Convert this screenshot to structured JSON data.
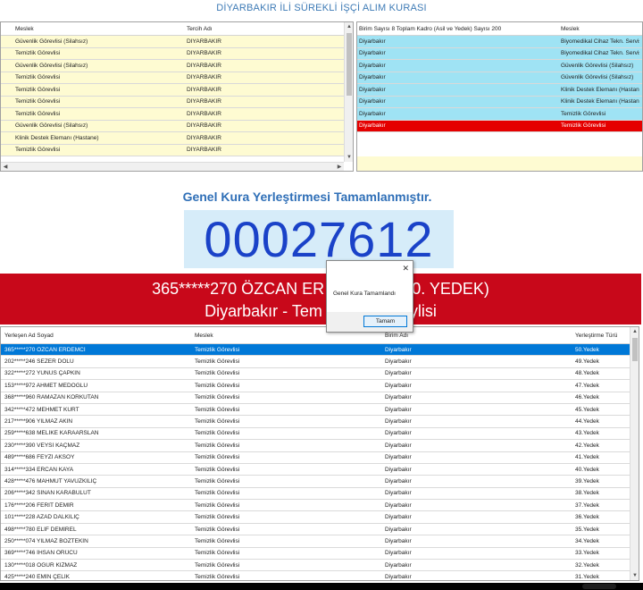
{
  "app": {
    "title": "DİYARBAKIR İLİ SÜREKLİ İŞÇİ ALIM KURASI"
  },
  "left_grid": {
    "headers": [
      "Meslek",
      "Tercih Adı"
    ],
    "rows": [
      [
        "Güvenlik Görevlisi (Silahsız)",
        "DIYARBAKIR"
      ],
      [
        "Temizlik Görevlisi",
        "DIYARBAKIR"
      ],
      [
        "Güvenlik Görevlisi (Silahsız)",
        "DIYARBAKIR"
      ],
      [
        "Temizlik Görevlisi",
        "DIYARBAKIR"
      ],
      [
        "Temizlik Görevlisi",
        "DIYARBAKIR"
      ],
      [
        "Temizlik Görevlisi",
        "DIYARBAKIR"
      ],
      [
        "Temizlik Görevlisi",
        "DIYARBAKIR"
      ],
      [
        "Güvenlik Görevlisi (Silahsız)",
        "DIYARBAKIR"
      ],
      [
        "Klinik Destek Elemanı (Hastane)",
        "DIYARBAKIR"
      ],
      [
        "Temizlik Görevlisi",
        "DIYARBAKIR"
      ]
    ]
  },
  "right_grid": {
    "headers": [
      "Birim Sayısı 8 Toplam Kadro (Asil ve Yedek) Sayısı 200",
      "Meslek"
    ],
    "rows": [
      [
        "Diyarbakır",
        "Biyomedikal Cihaz Tekn. Servis"
      ],
      [
        "Diyarbakır",
        "Biyomedikal Cihaz Tekn. Servis"
      ],
      [
        "Diyarbakır",
        "Güvenlik Görevlisi (Silahsız)"
      ],
      [
        "Diyarbakır",
        "Güvenlik Görevlisi (Silahsız)"
      ],
      [
        "Diyarbakır",
        "Klinik Destek Elemanı (Hastane)"
      ],
      [
        "Diyarbakır",
        "Klinik Destek Elemanı (Hastane)"
      ],
      [
        "Diyarbakır",
        "Temizlik Görevlisi"
      ],
      [
        "Diyarbakır",
        "Temizlik Görevlisi"
      ]
    ],
    "selected_index": 7
  },
  "result": {
    "heading": "Genel Kura Yerleştirmesi Tamamlanmıştır.",
    "code": "00027612",
    "banner_line1": "365*****270 ÖZCAN ER",
    "banner_line1_end": "0. YEDEK)",
    "banner_line2": "Diyarbakır - Tem",
    "banner_line2_end": "ylisi"
  },
  "dialog": {
    "message": "Genel Kura Tamamlandı",
    "ok_label": "Tamam",
    "close_symbol": "✕"
  },
  "bottom_grid": {
    "headers": [
      "Yerleşen Ad Soyad",
      "Meslek",
      "Birim Adı",
      "Yerleştirme Türü"
    ],
    "rows": [
      [
        "365*****270 ÖZCAN ERDEMCİ",
        "Temizlik Görevlisi",
        "Diyarbakır",
        "50.Yedek"
      ],
      [
        "202*****246 SEZER DOLU",
        "Temizlik Görevlisi",
        "Diyarbakır",
        "49.Yedek"
      ],
      [
        "322*****272 YUNUS ÇAPKIN",
        "Temizlik Görevlisi",
        "Diyarbakır",
        "48.Yedek"
      ],
      [
        "153*****972 AHMET MEDOĞLU",
        "Temizlik Görevlisi",
        "Diyarbakır",
        "47.Yedek"
      ],
      [
        "368*****960 RAMAZAN KORKUTAN",
        "Temizlik Görevlisi",
        "Diyarbakır",
        "46.Yedek"
      ],
      [
        "342*****472 MEHMET KURT",
        "Temizlik Görevlisi",
        "Diyarbakır",
        "45.Yedek"
      ],
      [
        "217*****906 YILMAZ AKIN",
        "Temizlik Görevlisi",
        "Diyarbakır",
        "44.Yedek"
      ],
      [
        "259*****638 MELİKE KARAARSLAN",
        "Temizlik Görevlisi",
        "Diyarbakır",
        "43.Yedek"
      ],
      [
        "230*****390 VEYSİ KAÇMAZ",
        "Temizlik Görevlisi",
        "Diyarbakır",
        "42.Yedek"
      ],
      [
        "489*****686 FEYZİ AKSOY",
        "Temizlik Görevlisi",
        "Diyarbakır",
        "41.Yedek"
      ],
      [
        "314*****334 ERCAN KAYA",
        "Temizlik Görevlisi",
        "Diyarbakır",
        "40.Yedek"
      ],
      [
        "428*****476 MAHMUT YAVUZKILIÇ",
        "Temizlik Görevlisi",
        "Diyarbakır",
        "39.Yedek"
      ],
      [
        "206*****342 SİNAN KARABULUT",
        "Temizlik Görevlisi",
        "Diyarbakır",
        "38.Yedek"
      ],
      [
        "176*****206 FERİT DEMİR",
        "Temizlik Görevlisi",
        "Diyarbakır",
        "37.Yedek"
      ],
      [
        "101*****228 AZAD DALKILIÇ",
        "Temizlik Görevlisi",
        "Diyarbakır",
        "36.Yedek"
      ],
      [
        "498*****780 ELİF DEMİREL",
        "Temizlik Görevlisi",
        "Diyarbakır",
        "35.Yedek"
      ],
      [
        "250*****074 YILMAZ BOZTEKİN",
        "Temizlik Görevlisi",
        "Diyarbakır",
        "34.Yedek"
      ],
      [
        "369*****746 İHSAN ÖRÜCÜ",
        "Temizlik Görevlisi",
        "Diyarbakır",
        "33.Yedek"
      ],
      [
        "130*****018 OĞUR KIZMAZ",
        "Temizlik Görevlisi",
        "Diyarbakır",
        "32.Yedek"
      ],
      [
        "425*****240 EMİN ÇELİK",
        "Temizlik Görevlisi",
        "Diyarbakır",
        "31.Yedek"
      ]
    ],
    "selected_index": 0
  },
  "icons": {
    "scroll_up": "▲",
    "scroll_down": "▼",
    "scroll_left": "◀",
    "scroll_right": "▶"
  },
  "colors": {
    "left_row_bg": "#fefbd2",
    "right_row_bg": "#9fe3f4",
    "selected_red": "#e50000",
    "banner_red": "#c8081a",
    "code_blue": "#1a42c8",
    "selection_blue": "#0078d7"
  }
}
